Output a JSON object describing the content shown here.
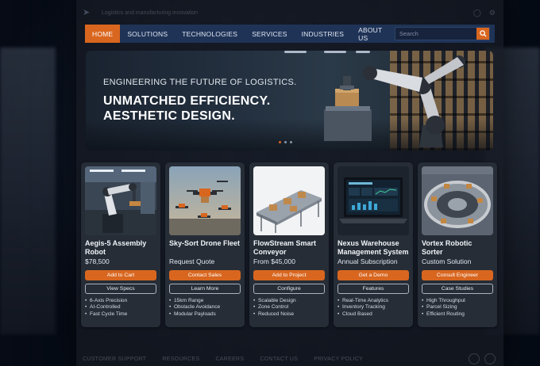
{
  "header": {
    "tagline": "Logistics and manufacturing innovation"
  },
  "nav": {
    "items": [
      {
        "label": "HOME",
        "active": true
      },
      {
        "label": "SOLUTIONS"
      },
      {
        "label": "TECHNOLOGIES"
      },
      {
        "label": "SERVICES"
      },
      {
        "label": "INDUSTRIES"
      },
      {
        "label": "ABOUT US"
      }
    ],
    "search_placeholder": "Search"
  },
  "hero": {
    "eyebrow": "ENGINEERING THE FUTURE OF LOGISTICS.",
    "title_line1": "UNMATCHED EFFICIENCY.",
    "title_line2": "AESTHETIC DESIGN.",
    "slide_count": 3,
    "active_slide": 1
  },
  "products": [
    {
      "name": "Aegis-5 Assembly Robot",
      "price": "$78,500",
      "primary": "Add to Cart",
      "secondary": "View Specs",
      "features": [
        "6-Axis Precision",
        "AI-Controlled",
        "Fast Cycle Time"
      ],
      "image": "robot-arm-icon"
    },
    {
      "name": "Sky-Sort Drone Fleet",
      "price": "Request Quote",
      "primary": "Contact Sales",
      "secondary": "Learn More",
      "features": [
        "15km Range",
        "Obstacle Avoidance",
        "Modular Payloads"
      ],
      "image": "drone-icon"
    },
    {
      "name": "FlowStream Smart Conveyor",
      "price": "From $45,000",
      "primary": "Add to Project",
      "secondary": "Configure",
      "features": [
        "Scalable Design",
        "Zone Control",
        "Reduced Noise"
      ],
      "image": "conveyor-icon"
    },
    {
      "name": "Nexus Warehouse Management System",
      "price": "Annual Subscription",
      "primary": "Get a Demo",
      "secondary": "Features",
      "features": [
        "Real-Time Analytics",
        "Inventory Tracking",
        "Cloud Based"
      ],
      "image": "laptop-dashboard-icon"
    },
    {
      "name": "Vortex Robotic Sorter",
      "price": "Custom Solution",
      "primary": "Consult Engineer",
      "secondary": "Case Studies",
      "features": [
        "High Throughput",
        "Parcel Sizing",
        "Efficient Routing"
      ],
      "image": "sorter-icon"
    }
  ],
  "footer": {
    "links": [
      "CUSTOMER SUPPORT",
      "RESOURCES",
      "CAREERS",
      "CONTACT US",
      "PRIVACY POLICY"
    ]
  },
  "colors": {
    "accent": "#d9661f",
    "nav_bg": "#1f3357",
    "card_bg": "#262d37"
  }
}
